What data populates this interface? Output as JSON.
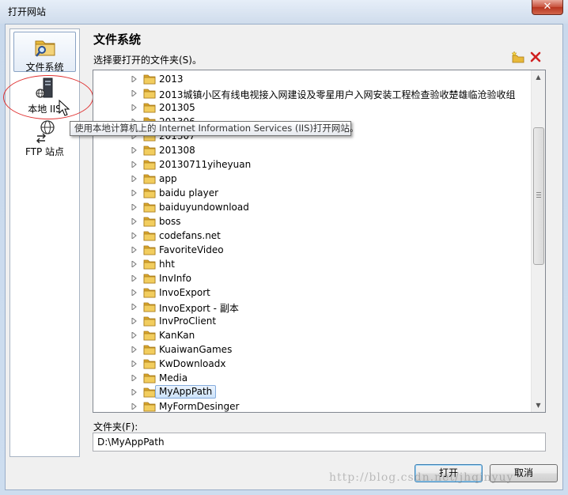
{
  "window": {
    "title": "打开网站",
    "close_glyph": "✕"
  },
  "nav": {
    "items": [
      {
        "id": "file-system",
        "label": "文件系统",
        "icon": "folder-search-icon",
        "selected": true
      },
      {
        "id": "local-iis",
        "label": "本地 IIS",
        "icon": "server-globe-icon",
        "selected": false
      },
      {
        "id": "ftp",
        "label": "FTP 站点",
        "icon": "globe-transfer-icon",
        "selected": false
      }
    ]
  },
  "tooltip": {
    "text": "使用本地计算机上的 Internet Information Services (IIS)打开网站。"
  },
  "main": {
    "heading": "文件系统",
    "subheading": "选择要打开的文件夹(S)。",
    "toolbar": {
      "new_folder": "new-folder-icon",
      "delete": "delete-icon",
      "delete_color": "#d02020"
    },
    "folders": [
      "2013",
      "2013城镇小区有线电视接入网建设及零星用户入网安装工程检查验收楚雄临沧验收组",
      "201305",
      "201306",
      "201307",
      "201308",
      "20130711yiheyuan",
      "app",
      "baidu player",
      "baiduyundownload",
      "boss",
      "codefans.net",
      "FavoriteVideo",
      "hht",
      "InvInfo",
      "InvoExport",
      "InvoExport - 副本",
      "InvProClient",
      "KanKan",
      "KuaiwanGames",
      "KwDownloadx",
      "Media",
      "MyAppPath",
      "MyFormDesinger"
    ],
    "selected_folder": "MyAppPath",
    "folder_field": {
      "label": "文件夹(F):",
      "value": "D:\\MyAppPath"
    }
  },
  "buttons": {
    "open": "打开",
    "cancel": "取消"
  },
  "watermark": "http://blog.csdn.net/jhqinyuy",
  "colors": {
    "annotation": "#e03030",
    "folder": "#e8b93a",
    "selection": "#cde3fa"
  }
}
